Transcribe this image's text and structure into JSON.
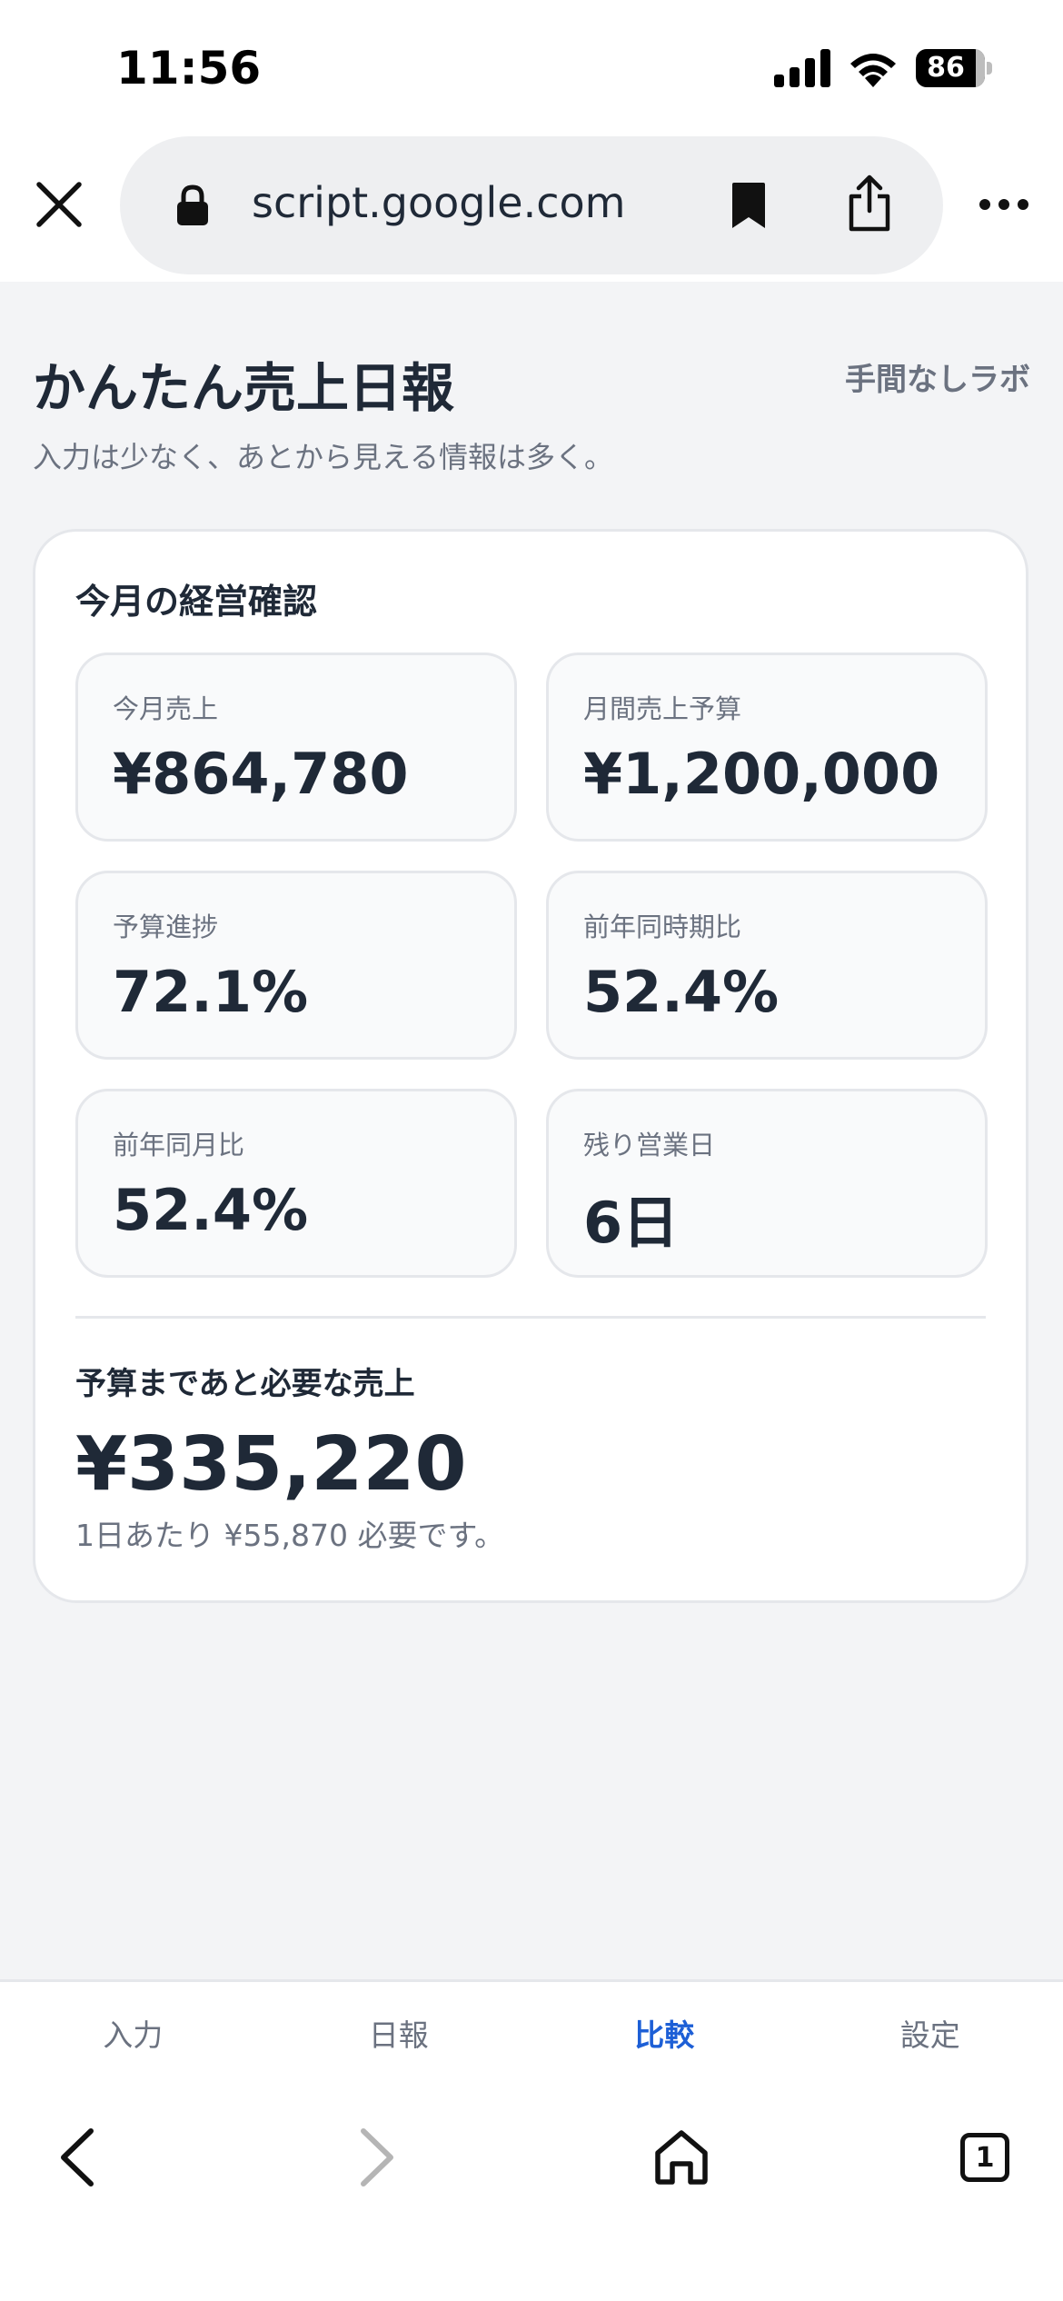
{
  "status_bar": {
    "time": "11:56",
    "battery_level": "86",
    "icons": [
      "signal-icon",
      "wifi-icon",
      "battery-icon"
    ]
  },
  "browser": {
    "url": "script.google.com",
    "icons": [
      "close-icon",
      "lock-icon",
      "bookmark-icon",
      "share-icon",
      "more-icon"
    ],
    "bottom_nav_icons": [
      "back-icon",
      "forward-icon",
      "home-icon",
      "tabs-icon"
    ],
    "open_tabs_count": "1"
  },
  "header": {
    "title": "かんたん売上日報",
    "brand": "手間なしラボ",
    "subtitle": "入力は少なく、あとから見える情報は多く。"
  },
  "summary": {
    "title": "今月の経営確認",
    "metrics": [
      {
        "label": "今月売上",
        "value": "¥864,780"
      },
      {
        "label": "月間売上予算",
        "value": "¥1,200,000"
      },
      {
        "label": "予算進捗",
        "value": "72.1%"
      },
      {
        "label": "前年同時期比",
        "value": "52.4%"
      },
      {
        "label": "前年同月比",
        "value": "52.4%"
      },
      {
        "label": "残り営業日",
        "value": "6日"
      }
    ],
    "remaining": {
      "label": "予算まであと必要な売上",
      "value": "¥335,220",
      "note": "1日あたり ¥55,870 必要です。"
    }
  },
  "tabs": [
    {
      "label": "入力",
      "active": false
    },
    {
      "label": "日報",
      "active": false
    },
    {
      "label": "比較",
      "active": true
    },
    {
      "label": "設定",
      "active": false
    }
  ],
  "colors": {
    "background": "#f3f4f6",
    "text_primary": "#1f2937",
    "text_secondary": "#6b7280",
    "accent": "#1d5fd6",
    "card_border": "#e5e7eb"
  }
}
